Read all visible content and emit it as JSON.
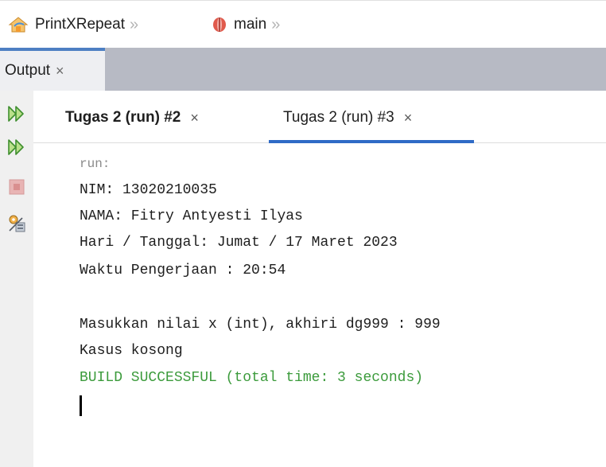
{
  "breadcrumb": {
    "project": "PrintXRepeat",
    "method": "main",
    "separator": "»",
    "project_icon": "project-icon",
    "method_icon": "method-icon"
  },
  "output_window": {
    "tab_label": "Output",
    "close_glyph": "×",
    "accent": "#4d7fc3"
  },
  "rail": {
    "buttons": [
      "rerun-icon",
      "rerun-with-options-icon",
      "stop-icon",
      "settings-icon"
    ]
  },
  "console_tabs": [
    {
      "label": "Tugas 2 (run) #2",
      "close": "×",
      "active": false
    },
    {
      "label": "Tugas 2 (run) #3",
      "close": "×",
      "active": true
    }
  ],
  "console": {
    "lines": [
      "run:",
      "NIM: 13020210035",
      "NAMA: Fitry Antyesti Ilyas",
      "Hari / Tanggal: Jumat / 17 Maret 2023",
      "Waktu Pengerjaan : 20:54",
      "",
      "Masukkan nilai x (int), akhiri dg999 : 999",
      "Kasus kosong",
      "BUILD SUCCESSFUL (total time: 3 seconds)"
    ],
    "success_color": "#3c9b3c"
  }
}
